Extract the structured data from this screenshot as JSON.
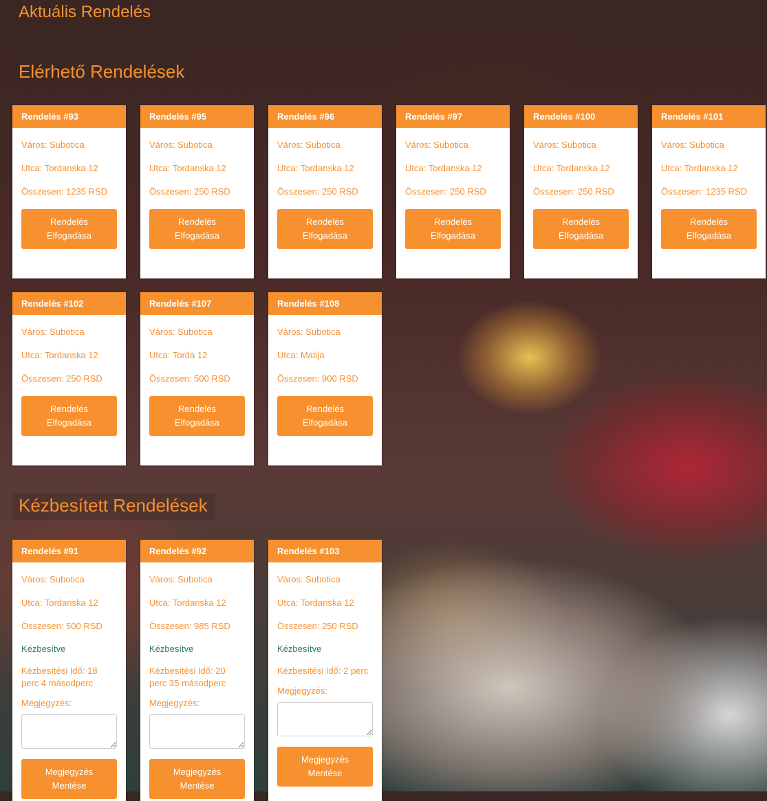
{
  "sections": {
    "current_title": "Aktuális Rendelés",
    "available_title": "Elérhető Rendelések",
    "delivered_title": "Kézbesített Rendelések"
  },
  "available": [
    {
      "title": "Rendelés #93",
      "city": "Város: Subotica",
      "street": "Utca: Tordanska 12",
      "total": "Összesen: 1235 RSD",
      "button_line1": "Rendelés",
      "button_line2": "Elfogadása"
    },
    {
      "title": "Rendelés #95",
      "city": "Város: Subotica",
      "street": "Utca: Tordanska 12",
      "total": "Összesen: 250 RSD",
      "button_line1": "Rendelés",
      "button_line2": "Elfogadása"
    },
    {
      "title": "Rendelés #96",
      "city": "Város: Subotica",
      "street": "Utca: Tordanska 12",
      "total": "Összesen: 250 RSD",
      "button_line1": "Rendelés",
      "button_line2": "Elfogadása"
    },
    {
      "title": "Rendelés #97",
      "city": "Város: Subotica",
      "street": "Utca: Tordanska 12",
      "total": "Összesen: 250 RSD",
      "button_line1": "Rendelés",
      "button_line2": "Elfogadása"
    },
    {
      "title": "Rendelés #100",
      "city": "Város: Subotica",
      "street": "Utca: Tordanska 12",
      "total": "Összesen: 250 RSD",
      "button_line1": "Rendelés",
      "button_line2": "Elfogadása"
    },
    {
      "title": "Rendelés #101",
      "city": "Város: Subotica",
      "street": "Utca: Tordanska 12",
      "total": "Összesen: 1235 RSD",
      "button_line1": "Rendelés",
      "button_line2": "Elfogadása"
    },
    {
      "title": "Rendelés #102",
      "city": "Város: Subotica",
      "street": "Utca: Tordanska 12",
      "total": "Összesen: 250 RSD",
      "button_line1": "Rendelés",
      "button_line2": "Elfogadása"
    },
    {
      "title": "Rendelés #107",
      "city": "Város: Subotica",
      "street": "Utca: Torda 12",
      "total": "Összesen: 500 RSD",
      "button_line1": "Rendelés",
      "button_line2": "Elfogadása"
    },
    {
      "title": "Rendelés #108",
      "city": "Város: Subotica",
      "street": "Utca: Matija",
      "total": "Összesen: 900 RSD",
      "button_line1": "Rendelés",
      "button_line2": "Elfogadása"
    }
  ],
  "delivered": [
    {
      "title": "Rendelés #91",
      "city": "Város: Subotica",
      "street": "Utca: Tordanska 12",
      "total": "Összesen: 500 RSD",
      "status": "Kézbesítve",
      "time": "Kézbesítési Idő: 18 perc 4 másodperc",
      "note_label": "Megjegyzés:",
      "note_value": "",
      "button_line1": "Megjegyzés",
      "button_line2": "Mentése"
    },
    {
      "title": "Rendelés #92",
      "city": "Város: Subotica",
      "street": "Utca: Tordanska 12",
      "total": "Összesen: 985 RSD",
      "status": "Kézbesítve",
      "time": "Kézbesítési Idő: 20 perc 35 másodperc",
      "note_label": "Megjegyzés:",
      "note_value": "",
      "button_line1": "Megjegyzés",
      "button_line2": "Mentése"
    },
    {
      "title": "Rendelés #103",
      "city": "Város: Subotica",
      "street": "Utca: Tordanska 12",
      "total": "Összesen: 250 RSD",
      "status": "Kézbesítve",
      "time": "Kézbesítési Idő: 2 perc",
      "note_label": "Megjegyzés:",
      "note_value": "",
      "button_line1": "Megjegyzés",
      "button_line2": "Mentése"
    }
  ]
}
